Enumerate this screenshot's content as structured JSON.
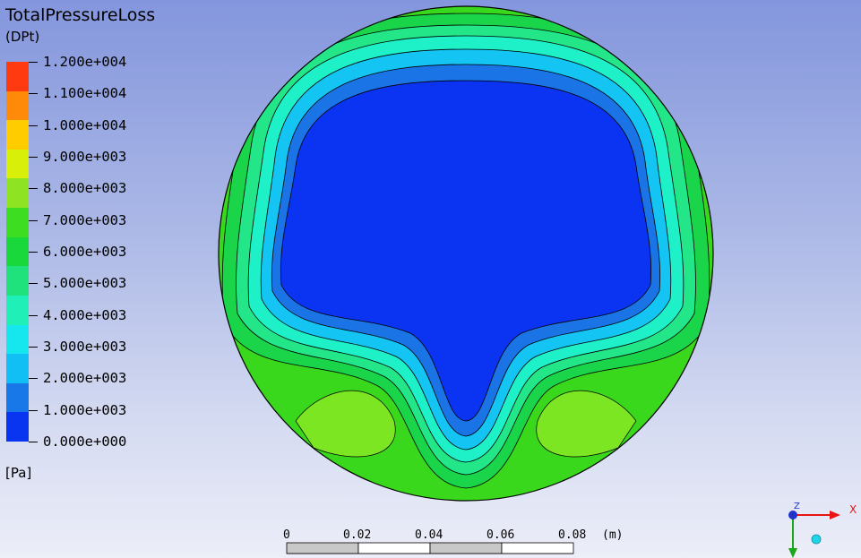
{
  "legend": {
    "title": "TotalPressureLoss",
    "subtitle": "(DPt)",
    "units": "[Pa]",
    "bands": [
      {
        "color": "#ff3a10"
      },
      {
        "color": "#ff8a0a"
      },
      {
        "color": "#ffcc00"
      },
      {
        "color": "#d8ef0a"
      },
      {
        "color": "#8ee322"
      },
      {
        "color": "#3dde22"
      },
      {
        "color": "#18d83c"
      },
      {
        "color": "#20e27c"
      },
      {
        "color": "#20f0b8"
      },
      {
        "color": "#16e6ee"
      },
      {
        "color": "#12bff4"
      },
      {
        "color": "#1878e8"
      },
      {
        "color": "#0a35f0"
      }
    ],
    "ticks": [
      "1.200e+004",
      "1.100e+004",
      "1.000e+004",
      "9.000e+003",
      "8.000e+003",
      "7.000e+003",
      "6.000e+003",
      "5.000e+003",
      "4.000e+003",
      "3.000e+003",
      "2.000e+003",
      "1.000e+003",
      "0.000e+000"
    ]
  },
  "scale_bar": {
    "labels": [
      "0",
      "0.02",
      "0.04",
      "0.06",
      "0.08"
    ],
    "unit": "(m)"
  },
  "triad": {
    "x_label": "X",
    "z_label": "Z",
    "x_color": "#e81414",
    "y_color": "#1aa81a",
    "z_color": "#2233cc"
  }
}
